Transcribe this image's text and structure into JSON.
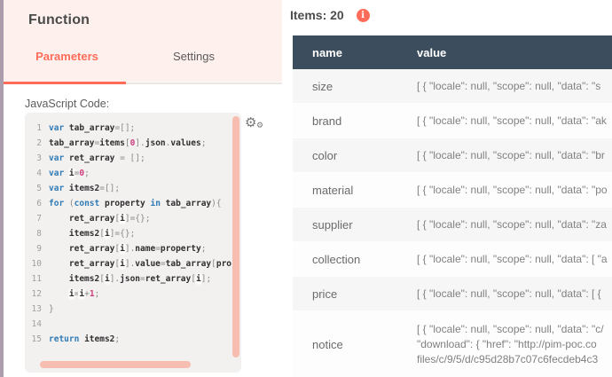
{
  "left_panel": {
    "title": "Function",
    "tabs": {
      "parameters": "Parameters",
      "settings": "Settings"
    },
    "code_label": "JavaScript Code:",
    "editor": {
      "lines": [
        "var tab_array=[];",
        "tab_array=items[0].json.values;",
        "var ret_array = [];",
        "var i=0;",
        "var items2=[];",
        "for (const property in tab_array){",
        "    ret_array[i]={};",
        "    items2[i]={};",
        "    ret_array[i].name=property;",
        "    ret_array[i].value=tab_array[pro",
        "    items2[i].json=ret_array[i];",
        "    i=i+1;",
        "}",
        "",
        "return items2;"
      ]
    }
  },
  "output_panel": {
    "items_label": "Items: 20",
    "table": {
      "columns": [
        "name",
        "value"
      ],
      "rows": [
        {
          "name": "size",
          "value": "[ { \"locale\": null, \"scope\": null, \"data\": \"s"
        },
        {
          "name": "brand",
          "value": "[ { \"locale\": null, \"scope\": null, \"data\": \"ak"
        },
        {
          "name": "color",
          "value": "[ { \"locale\": null, \"scope\": null, \"data\": \"br"
        },
        {
          "name": "material",
          "value": "[ { \"locale\": null, \"scope\": null, \"data\": \"po"
        },
        {
          "name": "supplier",
          "value": "[ { \"locale\": null, \"scope\": null, \"data\": \"za"
        },
        {
          "name": "collection",
          "value": "[ { \"locale\": null, \"scope\": null, \"data\": [ \"a"
        },
        {
          "name": "price",
          "value": "[ { \"locale\": null, \"scope\": null, \"data\": [ {"
        },
        {
          "name": "notice",
          "value": [
            "[ { \"locale\": null, \"scope\": null, \"data\": \"c/",
            "\"download\": { \"href\": \"http://pim-poc.co",
            "files/c/9/5/d/c95d28b7c07c6fecdeb4c3"
          ]
        }
      ]
    }
  },
  "icons": {
    "gear": "⚙",
    "gear_small": "⚙",
    "info": "i"
  },
  "colors": {
    "accent_red": "#ff6d5a",
    "scrollbar_salmon": "#f7bdb0",
    "table_header_bg": "#3c4d5e",
    "left_strip_purple": "#ab9dac",
    "panel_header_pink": "#fdf0ed",
    "code_keyword_blue": "#2e7bb5",
    "code_number_magenta": "#cf3e7e"
  }
}
